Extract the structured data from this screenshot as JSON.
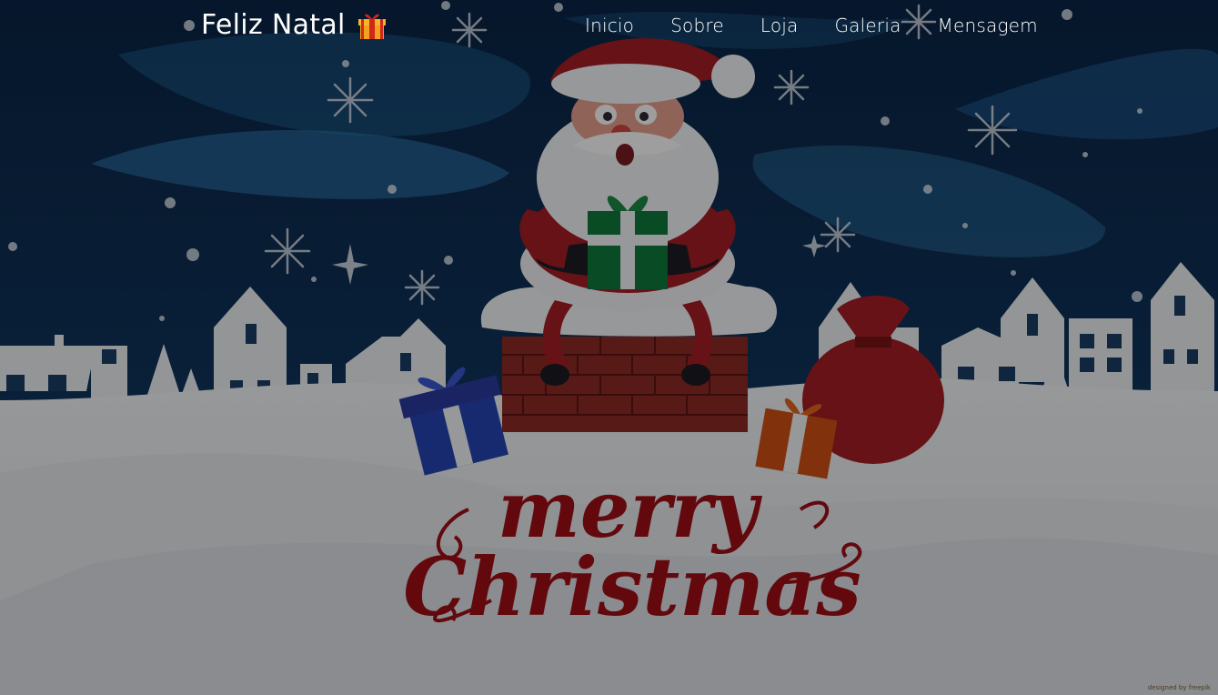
{
  "header": {
    "brand": "Feliz Natal",
    "brand_icon": "gift-icon"
  },
  "nav": {
    "items": [
      {
        "label": "Inicio"
      },
      {
        "label": "Sobre"
      },
      {
        "label": "Loja"
      },
      {
        "label": "Galeria"
      },
      {
        "label": "Mensagem"
      }
    ]
  },
  "hero": {
    "greeting_line1": "merry",
    "greeting_line2": "Christmas",
    "credit": "designed by freepik"
  },
  "colors": {
    "sky": "#0e2d52",
    "aurora": "#1e5a8c",
    "snow": "#eceff2",
    "greeting_red": "#a01018",
    "brick": "#8a2a22"
  }
}
